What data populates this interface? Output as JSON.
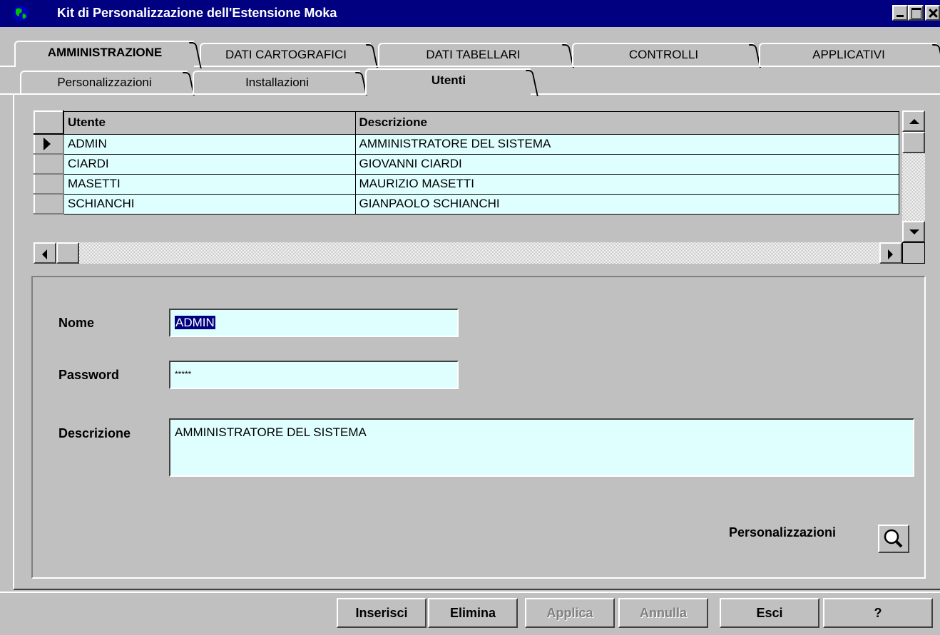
{
  "window": {
    "title": "Kit di Personalizzazione dell'Estensione Moka"
  },
  "top_tabs": [
    "AMMINISTRAZIONE",
    "DATI CARTOGRAFICI",
    "DATI TABELLARI",
    "CONTROLLI",
    "APPLICATIVI"
  ],
  "sub_tabs": [
    "Personalizzazioni",
    "Installazioni",
    "Utenti"
  ],
  "grid": {
    "columns": [
      "Utente",
      "Descrizione"
    ],
    "rows": [
      [
        "ADMIN",
        "AMMINISTRATORE DEL SISTEMA"
      ],
      [
        "CIARDI",
        "GIOVANNI CIARDI"
      ],
      [
        "MASETTI",
        "MAURIZIO MASETTI"
      ],
      [
        "SCHIANCHI",
        "GIANPAOLO SCHIANCHI"
      ]
    ]
  },
  "form": {
    "nome_label": "Nome",
    "nome_value": "ADMIN",
    "password_label": "Password",
    "password_value": "*****",
    "descrizione_label": "Descrizione",
    "descrizione_value": "AMMINISTRATORE DEL SISTEMA",
    "personalizzazioni_label": "Personalizzazioni"
  },
  "buttons": {
    "inserisci": "Inserisci",
    "elimina": "Elimina",
    "applica": "Applica",
    "annulla": "Annulla",
    "esci": "Esci",
    "help": "?"
  },
  "colors": {
    "titlebar": "#000080",
    "face": "#c0c0c0",
    "field": "#dfffff"
  }
}
